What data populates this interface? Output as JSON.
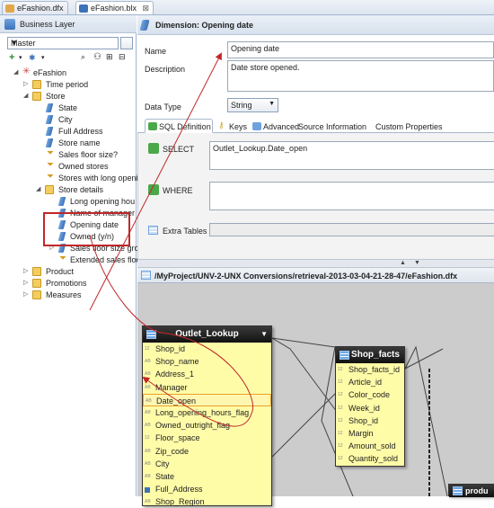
{
  "tabs": [
    {
      "label": "eFashion.dfx",
      "active": false
    },
    {
      "label": "eFashion.blx",
      "active": true
    }
  ],
  "left_panel": {
    "title": "Business Layer",
    "layer_select": "Master",
    "tree": [
      {
        "label": "eFashion",
        "type": "root",
        "expanded": true
      },
      {
        "label": "Time period",
        "type": "folder",
        "expanded": false
      },
      {
        "label": "Store",
        "type": "folder",
        "expanded": true
      },
      {
        "label": "State",
        "type": "dimension"
      },
      {
        "label": "City",
        "type": "dimension"
      },
      {
        "label": "Full Address",
        "type": "dimension"
      },
      {
        "label": "Store name",
        "type": "dimension"
      },
      {
        "label": "Sales floor size?",
        "type": "measure"
      },
      {
        "label": "Owned stores",
        "type": "filter"
      },
      {
        "label": "Stores with long openi",
        "type": "filter"
      },
      {
        "label": "Store details",
        "type": "folder",
        "expanded": true
      },
      {
        "label": "Long opening hou",
        "type": "dimension"
      },
      {
        "label": "Name of manager",
        "type": "dimension"
      },
      {
        "label": "Opening date",
        "type": "dimension",
        "selected": true
      },
      {
        "label": "Owned (y/n)",
        "type": "dimension"
      },
      {
        "label": "Sales floor size grou",
        "type": "dimension"
      },
      {
        "label": "Extended sales floo",
        "type": "filter"
      },
      {
        "label": "Product",
        "type": "folder",
        "expanded": false
      },
      {
        "label": "Promotions",
        "type": "folder",
        "expanded": false
      },
      {
        "label": "Measures",
        "type": "folder",
        "expanded": false
      }
    ]
  },
  "editor": {
    "title": "Dimension: Opening date",
    "name_label": "Name",
    "name_value": "Opening date",
    "description_label": "Description",
    "description_value": "Date store opened.",
    "datatype_label": "Data Type",
    "datatype_value": "String",
    "subtabs": [
      "SQL Definition",
      "Keys",
      "Advanced",
      "Source Information",
      "Custom Properties"
    ],
    "select_label": "SELECT",
    "select_value": "Outlet_Lookup.Date_open",
    "where_label": "WHERE",
    "where_value": "",
    "extra_tables_label": "Extra Tables"
  },
  "diagram": {
    "path": "/MyProject/UNV-2-UNX Conversions/retrieval-2013-03-04-21-28-47/eFashion.dfx",
    "tables": [
      {
        "name": "Outlet_Lookup",
        "columns": [
          "Shop_id",
          "Shop_name",
          "Address_1",
          "Manager",
          "Date_open",
          "Long_opening_hours_flag",
          "Owned_outright_flag",
          "Floor_space",
          "Zip_code",
          "City",
          "State",
          "Full_Address",
          "Shop_Region"
        ],
        "types": [
          "12",
          "AB",
          "AB",
          "AB",
          "AB",
          "AB",
          "AB",
          "12",
          "AB",
          "AB",
          "AB",
          "",
          "AB"
        ],
        "highlight": "Date_open"
      },
      {
        "name": "Shop_facts",
        "columns": [
          "Shop_facts_id",
          "Article_id",
          "Color_code",
          "Week_id",
          "Shop_id",
          "Margin",
          "Amount_sold",
          "Quantity_sold"
        ],
        "types": [
          "12",
          "12",
          "12",
          "12",
          "12",
          "12",
          "12",
          "12"
        ]
      },
      {
        "name": "produ",
        "columns": [],
        "types": []
      }
    ]
  },
  "colors": {
    "selection": "#c0282a",
    "table_fill": "#fffca8",
    "table_head": "#1a1a1a"
  }
}
